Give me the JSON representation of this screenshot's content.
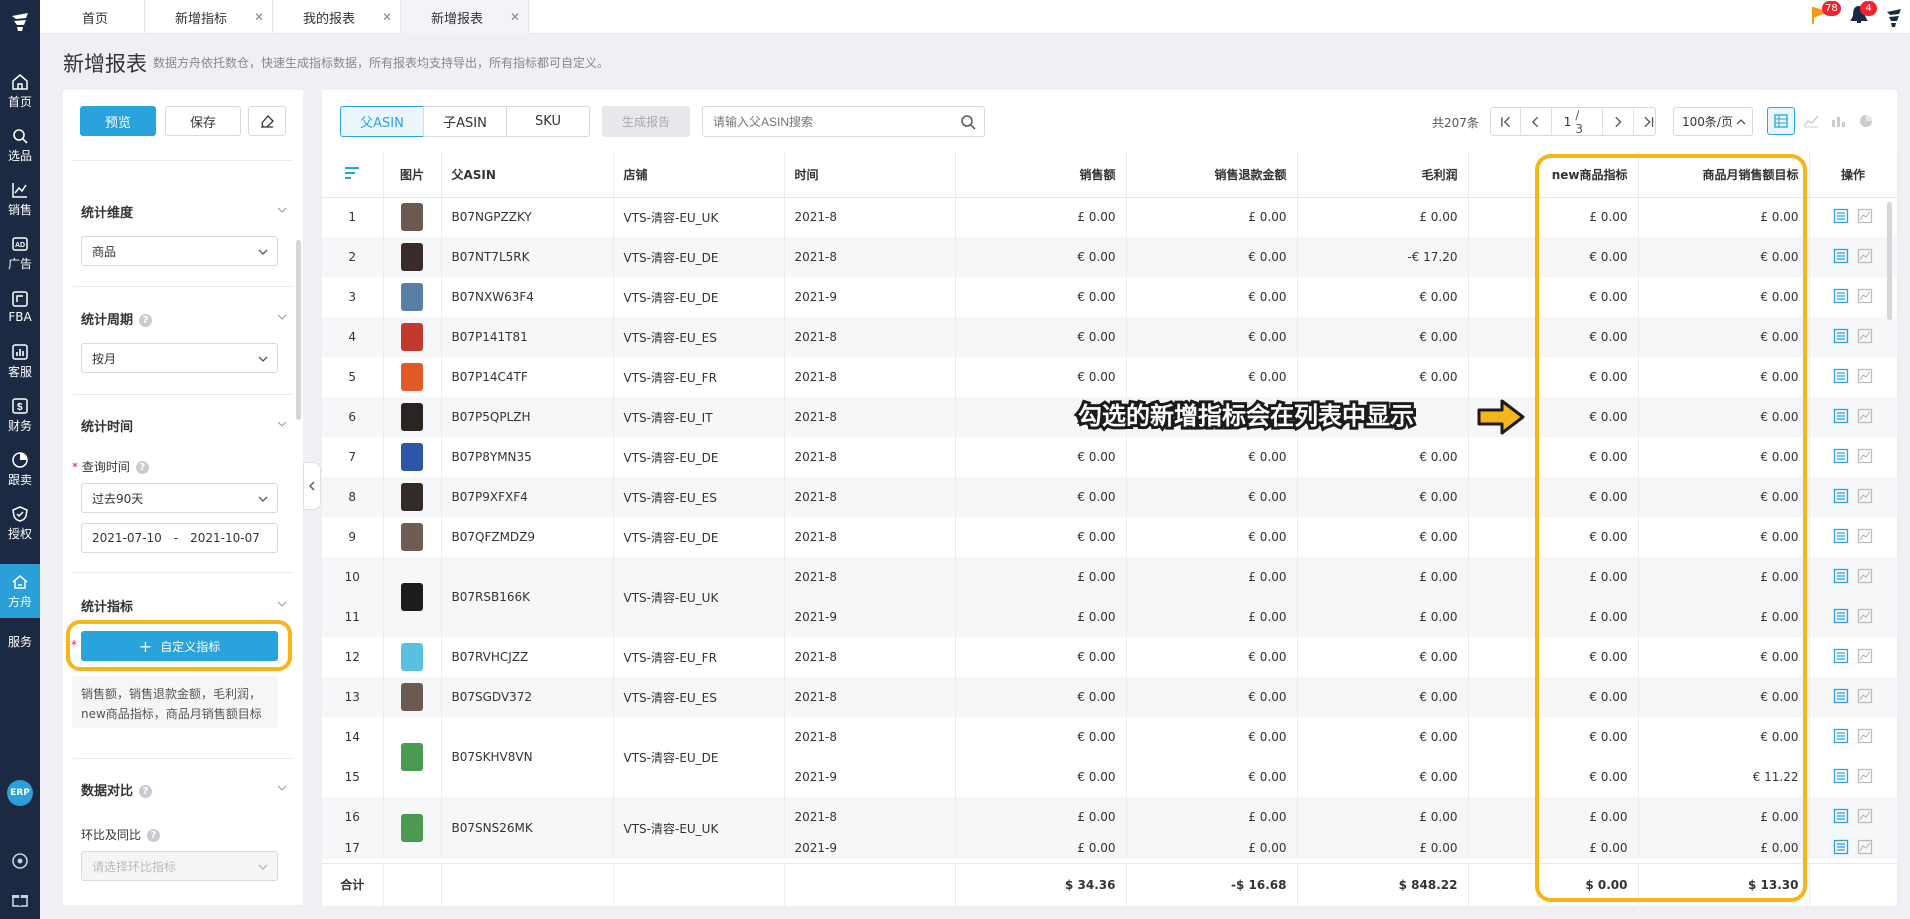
{
  "nav": {
    "items": [
      {
        "label": "首页",
        "icon": "home-icon"
      },
      {
        "label": "选品",
        "icon": "search-icon"
      },
      {
        "label": "销售",
        "icon": "trend-chart-icon"
      },
      {
        "label": "广告",
        "icon": "ad-icon"
      },
      {
        "label": "FBA",
        "icon": "fba-icon"
      },
      {
        "label": "客服",
        "icon": "bar-chart-icon"
      },
      {
        "label": "财务",
        "icon": "dollar-icon"
      },
      {
        "label": "跟卖",
        "icon": "pie-chart-icon"
      },
      {
        "label": "授权",
        "icon": "shield-icon"
      },
      {
        "label": "方舟",
        "icon": "ark-icon"
      },
      {
        "label": "服务",
        "icon": ""
      }
    ],
    "erp": "ERP"
  },
  "tabs": [
    {
      "label": "首页"
    },
    {
      "label": "新增指标"
    },
    {
      "label": "我的报表"
    },
    {
      "label": "新增报表"
    }
  ],
  "topbar": {
    "flag_count": "78",
    "bell_count": "4"
  },
  "page": {
    "title": "新增报表",
    "description": "数据方舟依托数仓，快速生成指标数据，所有报表均支持导出，所有指标都可自定义。"
  },
  "left": {
    "preview": "预览",
    "save": "保存",
    "dimension_title": "统计维度",
    "dimension_value": "商品",
    "period_title": "统计周期",
    "period_value": "按月",
    "time_title": "统计时间",
    "query_time_label": "查询时间",
    "query_time_value": "过去90天",
    "date_start": "2021-07-10",
    "date_sep": "-",
    "date_end": "2021-10-07",
    "metrics_title": "统计指标",
    "custom_metric_btn": "自定义指标",
    "metrics_selected": "销售额，销售退款金额，毛利润，new商品指标，商品月销售额目标",
    "compare_title": "数据对比",
    "compare_label": "环比及同比",
    "compare_placeholder": "请选择环比指标"
  },
  "toolbar": {
    "tab_parent": "父ASIN",
    "tab_child": "子ASIN",
    "tab_sku": "SKU",
    "generate": "生成报告",
    "search_placeholder": "请输入父ASIN搜索",
    "total": "共207条",
    "page_current": "1",
    "page_total": "/ 3",
    "page_size": "100条/页"
  },
  "table": {
    "headers": [
      "",
      "图片",
      "父ASIN",
      "店铺",
      "时间",
      "销售额",
      "销售退款金额",
      "毛利润",
      "",
      "new商品指标",
      "商品月销售额目标",
      "操作"
    ],
    "rows": [
      {
        "no": "1",
        "asin": "B07NGPZZKY",
        "shop": "VTS-清容-EU_UK",
        "time": "2021-8",
        "sales": "£ 0.00",
        "refund": "£ 0.00",
        "profit": "£ 0.00",
        "newm": "£ 0.00",
        "target": "£ 0.00",
        "img": "#6b5a52"
      },
      {
        "no": "2",
        "asin": "B07NT7L5RK",
        "shop": "VTS-清容-EU_DE",
        "time": "2021-8",
        "sales": "€ 0.00",
        "refund": "€ 0.00",
        "profit": "-€ 17.20",
        "newm": "€ 0.00",
        "target": "€ 0.00",
        "img": "#3a2a2a"
      },
      {
        "no": "3",
        "asin": "B07NXW63F4",
        "shop": "VTS-清容-EU_DE",
        "time": "2021-9",
        "sales": "€ 0.00",
        "refund": "€ 0.00",
        "profit": "€ 0.00",
        "newm": "€ 0.00",
        "target": "€ 0.00",
        "img": "#5a7fa5"
      },
      {
        "no": "4",
        "asin": "B07P141T81",
        "shop": "VTS-清容-EU_ES",
        "time": "2021-8",
        "sales": "€ 0.00",
        "refund": "€ 0.00",
        "profit": "€ 0.00",
        "newm": "€ 0.00",
        "target": "€ 0.00",
        "img": "#c23a2e"
      },
      {
        "no": "5",
        "asin": "B07P14C4TF",
        "shop": "VTS-清容-EU_FR",
        "time": "2021-8",
        "sales": "€ 0.00",
        "refund": "€ 0.00",
        "profit": "€ 0.00",
        "newm": "€ 0.00",
        "target": "€ 0.00",
        "img": "#e05a25"
      },
      {
        "no": "6",
        "asin": "B07P5QPLZH",
        "shop": "VTS-清容-EU_IT",
        "time": "2021-8",
        "sales": "",
        "refund": "",
        "profit": "",
        "newm": "€ 0.00",
        "target": "€ 0.00",
        "img": "#2a2522"
      },
      {
        "no": "7",
        "asin": "B07P8YMN35",
        "shop": "VTS-清容-EU_DE",
        "time": "2021-8",
        "sales": "€ 0.00",
        "refund": "€ 0.00",
        "profit": "€ 0.00",
        "newm": "€ 0.00",
        "target": "€ 0.00",
        "img": "#2d55a8"
      },
      {
        "no": "8",
        "asin": "B07P9XFXF4",
        "shop": "VTS-清容-EU_ES",
        "time": "2021-8",
        "sales": "€ 0.00",
        "refund": "€ 0.00",
        "profit": "€ 0.00",
        "newm": "€ 0.00",
        "target": "€ 0.00",
        "img": "#332b27"
      },
      {
        "no": "9",
        "asin": "B07QFZMDZ9",
        "shop": "VTS-清容-EU_DE",
        "time": "2021-8",
        "sales": "€ 0.00",
        "refund": "€ 0.00",
        "profit": "€ 0.00",
        "newm": "€ 0.00",
        "target": "€ 0.00",
        "img": "#6e5d55"
      },
      {
        "no": "10",
        "asin": "B07RSB166K",
        "shop": "VTS-清容-EU_UK",
        "time": "2021-8",
        "sales": "£ 0.00",
        "refund": "£ 0.00",
        "profit": "£ 0.00",
        "newm": "£ 0.00",
        "target": "£ 0.00",
        "img": "#1c1c1c",
        "span": "start"
      },
      {
        "no": "11",
        "asin": "",
        "shop": "",
        "time": "2021-9",
        "sales": "£ 0.00",
        "refund": "£ 0.00",
        "profit": "£ 0.00",
        "newm": "£ 0.00",
        "target": "£ 0.00",
        "img": "",
        "span": "cont"
      },
      {
        "no": "12",
        "asin": "B07RVHCJZZ",
        "shop": "VTS-清容-EU_FR",
        "time": "2021-8",
        "sales": "€ 0.00",
        "refund": "€ 0.00",
        "profit": "€ 0.00",
        "newm": "€ 0.00",
        "target": "€ 0.00",
        "img": "#5ac0e0"
      },
      {
        "no": "13",
        "asin": "B07SGDV372",
        "shop": "VTS-清容-EU_ES",
        "time": "2021-8",
        "sales": "€ 0.00",
        "refund": "€ 0.00",
        "profit": "€ 0.00",
        "newm": "€ 0.00",
        "target": "€ 0.00",
        "img": "#6b5a52"
      },
      {
        "no": "14",
        "asin": "B07SKHV8VN",
        "shop": "VTS-清容-EU_DE",
        "time": "2021-8",
        "sales": "€ 0.00",
        "refund": "€ 0.00",
        "profit": "€ 0.00",
        "newm": "€ 0.00",
        "target": "€ 0.00",
        "img": "#4a9a52",
        "span": "start"
      },
      {
        "no": "15",
        "asin": "",
        "shop": "",
        "time": "2021-9",
        "sales": "€ 0.00",
        "refund": "€ 0.00",
        "profit": "€ 0.00",
        "newm": "€ 0.00",
        "target": "€ 11.22",
        "img": "",
        "span": "cont"
      },
      {
        "no": "16",
        "asin": "B07SNS26MK",
        "shop": "VTS-清容-EU_UK",
        "time": "2021-8",
        "sales": "£ 0.00",
        "refund": "£ 0.00",
        "profit": "£ 0.00",
        "newm": "£ 0.00",
        "target": "£ 0.00",
        "img": "#4a9a52",
        "span": "start"
      },
      {
        "no": "17",
        "asin": "",
        "shop": "",
        "time": "2021-9",
        "sales": "£ 0.00",
        "refund": "£ 0.00",
        "profit": "£ 0.00",
        "newm": "£ 0.00",
        "target": "£ 0.00",
        "img": "",
        "span": "cont"
      }
    ],
    "footer": {
      "label": "合计",
      "sales": "$ 34.36",
      "refund": "-$ 16.68",
      "profit": "$ 848.22",
      "newm": "$ 0.00",
      "target": "$ 13.30"
    }
  },
  "annotation": {
    "text": "勾选的新增指标会在列表中显示"
  },
  "colors": {
    "accent": "#29a3db",
    "highlight": "#f6b51a",
    "nav": "#1b2a42"
  }
}
